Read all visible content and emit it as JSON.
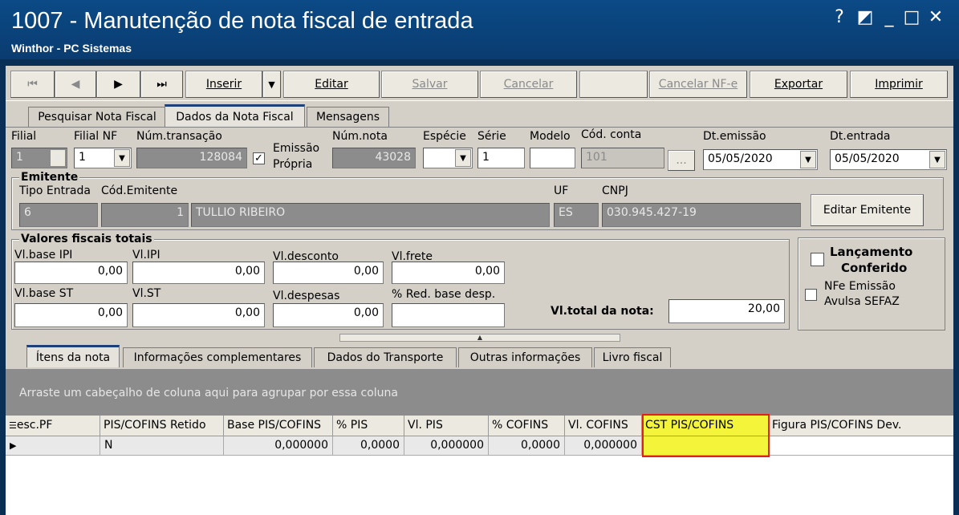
{
  "window": {
    "title": "1007 - Manutenção de nota fiscal de entrada",
    "subtitle": "Winthor - PC Sistemas",
    "controls": [
      "?",
      "◩",
      "_",
      "□",
      "✕"
    ]
  },
  "toolbar": {
    "first": "⏮",
    "prev": "◀",
    "next": "▶",
    "last": "⏭",
    "inserir": "Inserir",
    "editar": "Editar",
    "salvar": "Salvar",
    "cancelar": "Cancelar",
    "cancelar_nfe": "Cancelar NF-e",
    "exportar": "Exportar",
    "imprimir": "Imprimir"
  },
  "tabs": [
    "Pesquisar Nota Fiscal",
    "Dados da Nota Fiscal",
    "Mensagens"
  ],
  "header": {
    "filial_label": "Filial",
    "filial_value": "1",
    "filial_nf_label": "Filial NF",
    "filial_nf_value": "1",
    "num_transacao_label": "Núm.transação",
    "num_transacao_value": "128084",
    "emissao_propria_label_1": "Emissão",
    "emissao_propria_label_2": "Própria",
    "num_nota_label": "Núm.nota",
    "num_nota_value": "43028",
    "especie_label": "Espécie",
    "serie_label": "Série",
    "serie_value": "1",
    "modelo_label": "Modelo",
    "cod_conta_label": "Cód. conta",
    "cod_conta_value": "101",
    "ellipsis": "...",
    "dt_emissao_label": "Dt.emissão",
    "dt_emissao_value": "05/05/2020",
    "dt_entrada_label": "Dt.entrada",
    "dt_entrada_value": "05/05/2020"
  },
  "emitente": {
    "title": "Emitente",
    "tipo_entrada_label": "Tipo Entrada",
    "tipo_entrada_value": "6",
    "cod_emitente_label": "Cód.Emitente",
    "cod_emitente_value": "1",
    "nome_value": "TULLIO RIBEIRO",
    "uf_label": "UF",
    "uf_value": "ES",
    "cnpj_label": "CNPJ",
    "cnpj_value": "030.945.427-19",
    "editar_button": "Editar Emitente"
  },
  "valores": {
    "title": "Valores fiscais totais",
    "vl_base_ipi_label": "Vl.base IPI",
    "vl_base_ipi_value": "0,00",
    "vl_ipi_label": "Vl.IPI",
    "vl_ipi_value": "0,00",
    "vl_desconto_label": "Vl.desconto",
    "vl_desconto_value": "0,00",
    "vl_frete_label": "Vl.frete",
    "vl_frete_value": "0,00",
    "vl_base_st_label": "Vl.base ST",
    "vl_base_st_value": "0,00",
    "vl_st_label": "Vl.ST",
    "vl_st_value": "0,00",
    "vl_despesas_label": "Vl.despesas",
    "vl_despesas_value": "0,00",
    "red_base_label": "% Red. base desp.",
    "red_base_value": "",
    "vl_total_label": "Vl.total da nota:",
    "vl_total_value": "20,00"
  },
  "side_options": {
    "lancamento_1": "Lançamento",
    "lancamento_2": "Conferido",
    "nfe_1": "NFe Emissão",
    "nfe_2": "Avulsa SEFAZ"
  },
  "subtabs": [
    "Ítens da nota",
    "Informações complementares",
    "Dados do Transporte",
    "Outras informações",
    "Livro fiscal"
  ],
  "grid": {
    "group_hint": "Arraste um cabeçalho de coluna aqui para agrupar por essa coluna",
    "columns": [
      "esc.PF",
      "PIS/COFINS Retido",
      "Base PIS/COFINS",
      "% PIS",
      "Vl. PIS",
      "% COFINS",
      "Vl. COFINS",
      "CST PIS/COFINS",
      "Figura PIS/COFINS Dev."
    ],
    "row": [
      "",
      "N",
      "0,000000",
      "0,0000",
      "0,000000",
      "0,0000",
      "0,000000",
      "",
      ""
    ],
    "highlight_color": "#f4f53a",
    "highlight_border": "#e0201e"
  }
}
